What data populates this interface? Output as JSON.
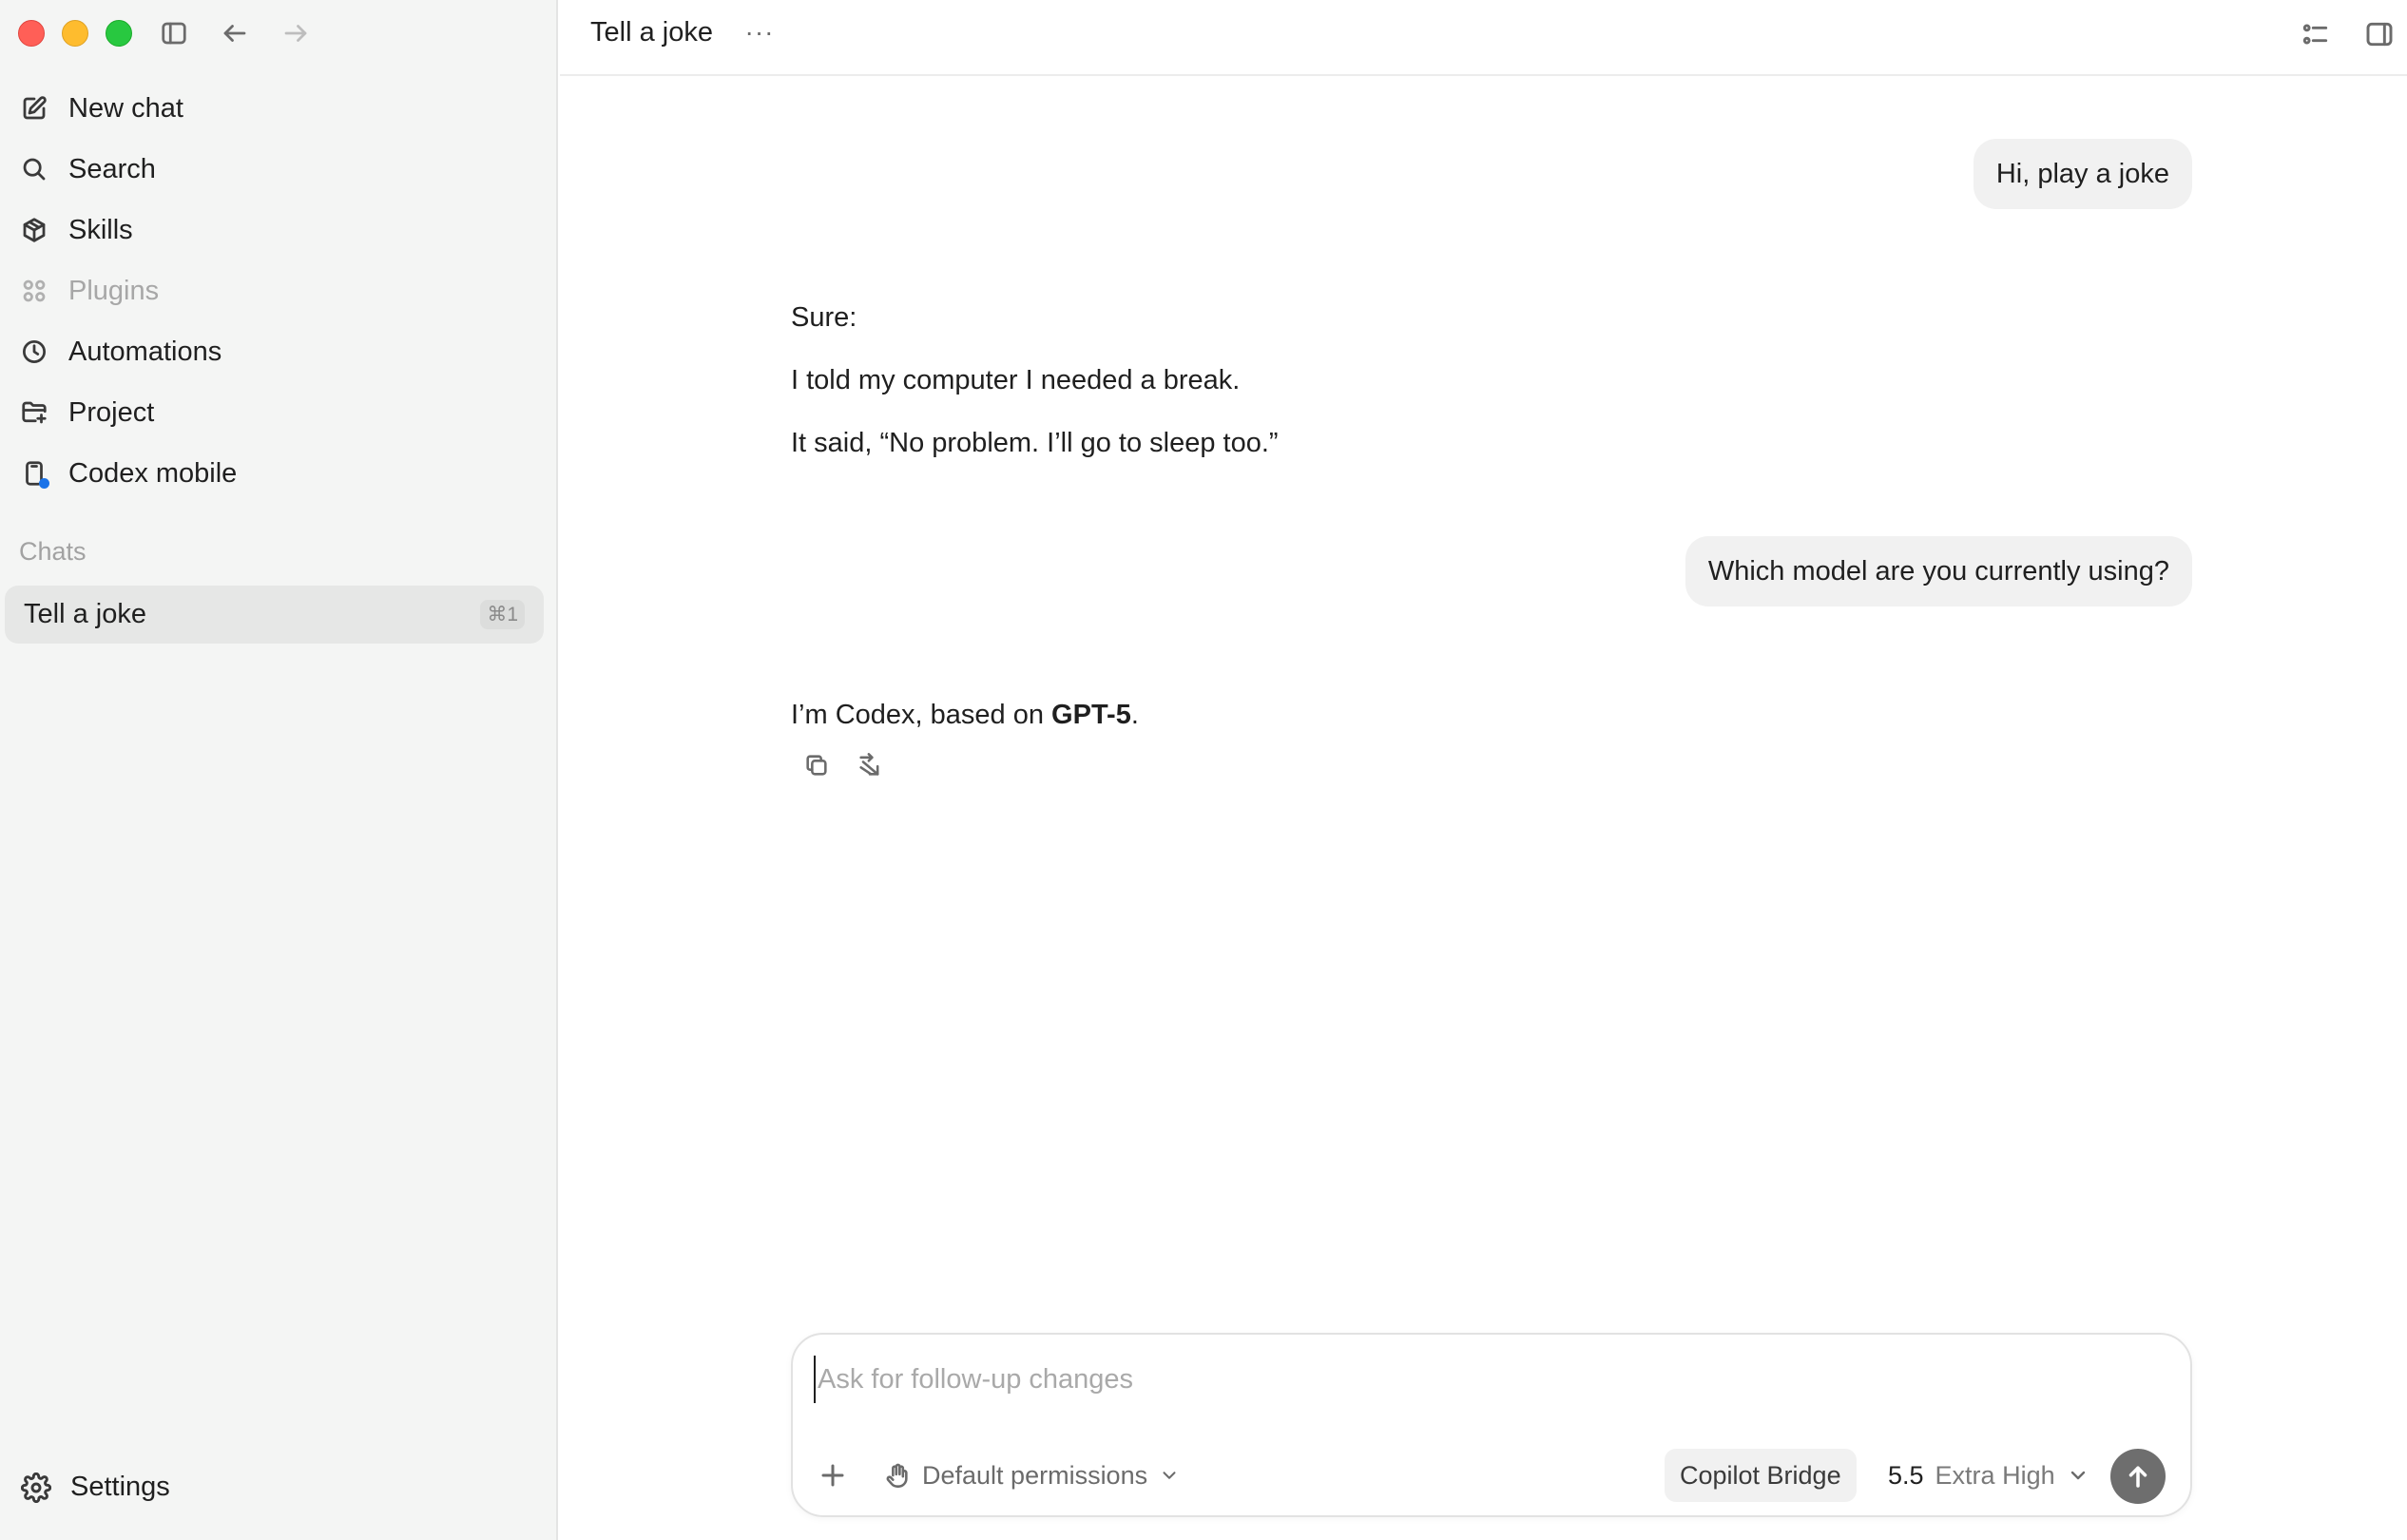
{
  "sidebar": {
    "nav": [
      {
        "label": "New chat",
        "icon": "new-chat-icon"
      },
      {
        "label": "Search",
        "icon": "search-icon"
      },
      {
        "label": "Skills",
        "icon": "skills-icon"
      },
      {
        "label": "Plugins",
        "icon": "plugins-icon",
        "disabled": true
      },
      {
        "label": "Automations",
        "icon": "clock-icon"
      },
      {
        "label": "Project",
        "icon": "folder-plus-icon"
      },
      {
        "label": "Codex mobile",
        "icon": "phone-icon"
      }
    ],
    "section_label": "Chats",
    "chats": [
      {
        "title": "Tell a joke",
        "shortcut": "⌘1",
        "active": true
      }
    ],
    "settings_label": "Settings"
  },
  "header": {
    "title": "Tell a joke",
    "more_label": "···"
  },
  "conversation": {
    "user_1": "Hi, play a joke",
    "assistant_1": {
      "line1": "Sure:",
      "line2": "I told my computer I needed a break.",
      "line3": "It said, “No problem. I’ll go to sleep too.”"
    },
    "user_2": "Which model are you currently using?",
    "assistant_2": {
      "prefix": "I’m Codex, based on ",
      "bold": "GPT-5",
      "suffix": "."
    }
  },
  "composer": {
    "placeholder": "Ask for follow-up changes",
    "permissions_label": "Default permissions",
    "chip_label": "Copilot Bridge",
    "model_version": "5.5",
    "model_effort": "Extra High"
  },
  "colors": {
    "sidebar_bg": "#f4f5f4",
    "active_chat_bg": "#e6e7e6",
    "user_bubble_bg": "#f1f1f1",
    "send_button_bg": "#6e6e6e",
    "mobile_badge": "#1a73e8"
  }
}
